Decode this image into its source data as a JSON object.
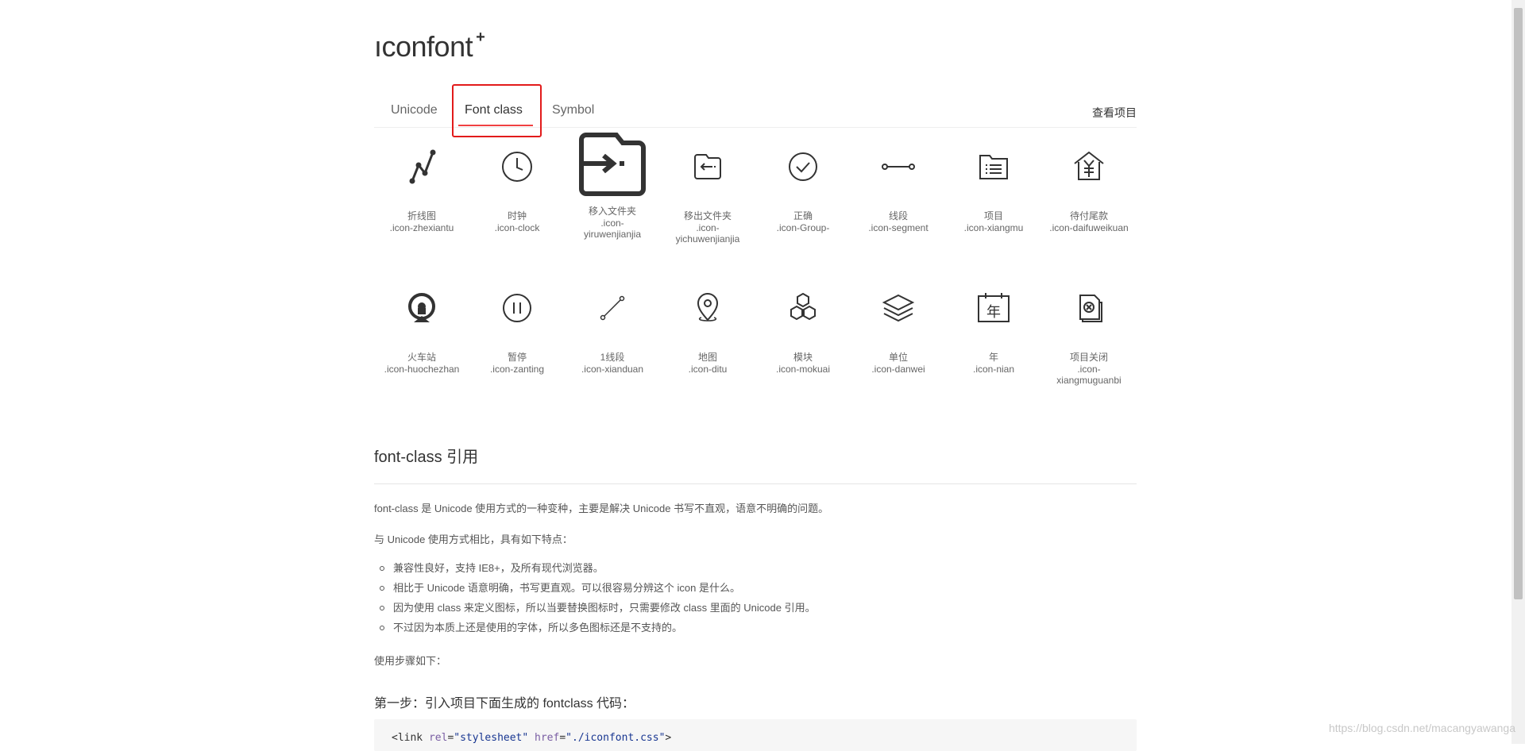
{
  "logo": {
    "text": "ıconfont",
    "plus": "+"
  },
  "tabs": [
    {
      "label": "Unicode",
      "active": false
    },
    {
      "label": "Font class",
      "active": true
    },
    {
      "label": "Symbol",
      "active": false
    }
  ],
  "view_project_label": "查看项目",
  "accent_color": "#f04142",
  "highlight_color": "#e21b1b",
  "icons": [
    {
      "label": "折线图",
      "cls": ".icon-zhexiantu",
      "icon": "polyline-chart-icon"
    },
    {
      "label": "时钟",
      "cls": ".icon-clock",
      "icon": "clock-icon"
    },
    {
      "label": "移入文件夹",
      "cls": ".icon-yiruwenjianjia",
      "icon": "folder-move-in-icon"
    },
    {
      "label": "移出文件夹",
      "cls": ".icon-yichuwenjianjia",
      "icon": "folder-move-out-icon"
    },
    {
      "label": "正确",
      "cls": ".icon-Group-",
      "icon": "check-circle-icon"
    },
    {
      "label": "线段",
      "cls": ".icon-segment",
      "icon": "segment-icon"
    },
    {
      "label": "项目",
      "cls": ".icon-xiangmu",
      "icon": "project-folder-icon"
    },
    {
      "label": "待付尾款",
      "cls": ".icon-daifuweikuan",
      "icon": "pending-payment-icon"
    },
    {
      "label": "火车站",
      "cls": ".icon-huochezhan",
      "icon": "train-station-icon"
    },
    {
      "label": "暂停",
      "cls": ".icon-zanting",
      "icon": "pause-circle-icon"
    },
    {
      "label": "1线段",
      "cls": ".icon-xianduan",
      "icon": "line-segment-icon"
    },
    {
      "label": "地图",
      "cls": ".icon-ditu",
      "icon": "map-pin-icon"
    },
    {
      "label": "模块",
      "cls": ".icon-mokuai",
      "icon": "module-hexagon-icon"
    },
    {
      "label": "单位",
      "cls": ".icon-danwei",
      "icon": "layers-icon"
    },
    {
      "label": "年",
      "cls": ".icon-nian",
      "icon": "calendar-year-icon"
    },
    {
      "label": "项目关闭",
      "cls": ".icon-xiangmuguanbi",
      "icon": "project-close-icon"
    }
  ],
  "nian_glyph": "年",
  "section": {
    "title": "font-class 引用",
    "intro": "font-class 是 Unicode 使用方式的一种变种，主要是解决 Unicode 书写不直观，语意不明确的问题。",
    "compare": "与 Unicode 使用方式相比，具有如下特点：",
    "features": [
      "兼容性良好，支持 IE8+，及所有现代浏览器。",
      "相比于 Unicode 语意明确，书写更直观。可以很容易分辨这个 icon 是什么。",
      "因为使用 class 来定义图标，所以当要替换图标时，只需要修改 class 里面的 Unicode 引用。",
      "不过因为本质上还是使用的字体，所以多色图标还是不支持的。"
    ],
    "steps_label": "使用步骤如下：",
    "step1_title": "第一步：引入项目下面生成的 fontclass 代码：",
    "code": {
      "open": "<",
      "tag": "link",
      "attr1": "rel",
      "val1": "\"stylesheet\"",
      "attr2": "href",
      "val2": "\"./iconfont.css\"",
      "close": ">",
      "eq": "="
    }
  },
  "watermark": "https://blog.csdn.net/macangyawanga"
}
